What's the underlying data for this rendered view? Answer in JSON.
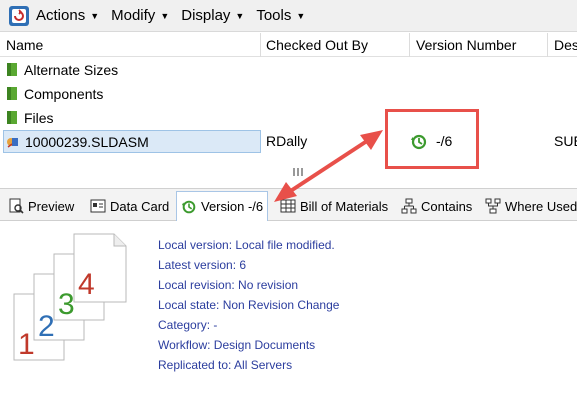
{
  "menubar": {
    "items": [
      {
        "label": "Actions"
      },
      {
        "label": "Modify"
      },
      {
        "label": "Display"
      },
      {
        "label": "Tools"
      }
    ]
  },
  "columns": {
    "name": "Name",
    "checked_out_by": "Checked Out By",
    "version_number": "Version Number",
    "description_partial": "Des"
  },
  "files": [
    {
      "name": "Alternate Sizes",
      "type": "folder"
    },
    {
      "name": "Components",
      "type": "folder"
    },
    {
      "name": "Files",
      "type": "folder"
    },
    {
      "name": "10000239.SLDASM",
      "type": "assembly",
      "checked_out_by": "RDally",
      "version": "-/6",
      "description_partial": "SUE"
    }
  ],
  "tabs": [
    {
      "label": "Preview"
    },
    {
      "label": "Data Card"
    },
    {
      "label": "Version -/6"
    },
    {
      "label": "Bill of Materials"
    },
    {
      "label": "Contains"
    },
    {
      "label": "Where Used"
    }
  ],
  "details": {
    "local_version": "Local version: Local file modified.",
    "latest_version": "Latest version: 6",
    "local_revision": "Local revision: No revision",
    "local_state": "Local state: Non Revision Change",
    "category": "Category: -",
    "workflow": "Workflow: Design Documents",
    "replicated": "Replicated to: All Servers"
  },
  "version_stack_numbers": [
    "1",
    "2",
    "3",
    "4"
  ],
  "colors": {
    "annotation_red": "#e8504a",
    "link_blue": "#2b3d9e",
    "selection": "#dbe9f7",
    "folder_green": "#5aa832",
    "version_green": "#3c9a2e"
  }
}
